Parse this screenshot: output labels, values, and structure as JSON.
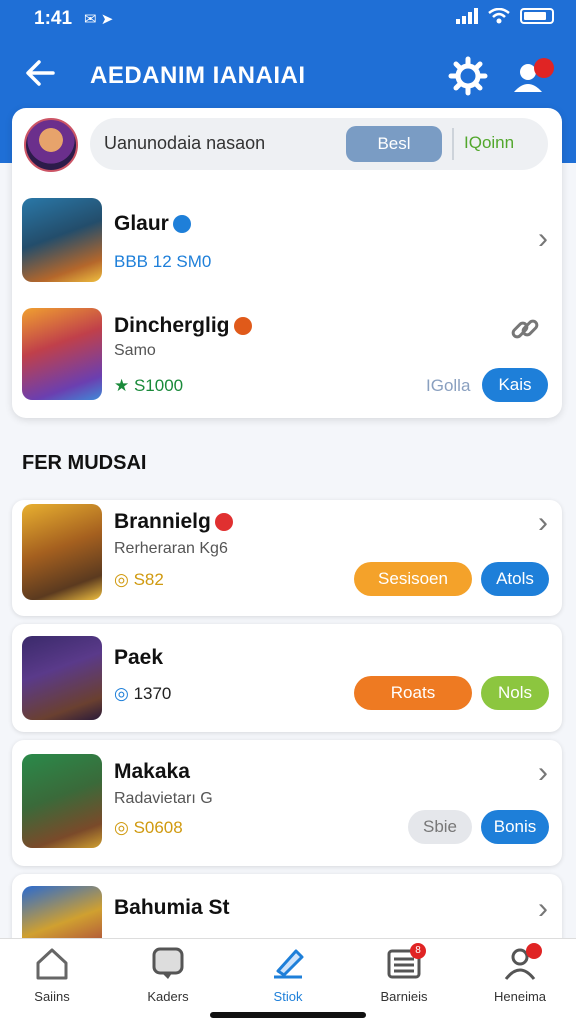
{
  "status": {
    "time": "1:41",
    "left_icons": "✉ ➤",
    "right_icons": [
      "signal-icon",
      "wifi-icon",
      "battery-icon"
    ]
  },
  "header": {
    "title": "AEDANIM IANAIAI"
  },
  "search": {
    "text": "Uanunodaia nasaon",
    "button": "Besl",
    "link": "IQoinn"
  },
  "featured": [
    {
      "name": "Glaur",
      "meta": "BBB  12  SM0",
      "action": "chevron"
    },
    {
      "name": "Dincherglig",
      "sub": "Samo",
      "meta": "★ S1000",
      "link": "IGolla",
      "button": "Kais"
    }
  ],
  "section_title": "FER MUDSAI",
  "list": [
    {
      "name": "Brannielg",
      "sub": "Rerheraran Kg6",
      "meta": "S82",
      "btn1": "Sesisoen",
      "btn2": "Atols"
    },
    {
      "name": "Paek",
      "meta": "1370",
      "btn1": "Roats",
      "btn2": "Nols"
    },
    {
      "name": "Makaka",
      "sub": "Radavietarı G",
      "meta": "S0608",
      "btn1": "Sbie",
      "btn2": "Bonis"
    },
    {
      "name": "Bahumia St"
    }
  ],
  "nav": [
    {
      "label": "Saiins",
      "icon": "home-icon"
    },
    {
      "label": "Kaders",
      "icon": "chat-icon"
    },
    {
      "label": "Stiok",
      "icon": "pencil-icon",
      "active": true
    },
    {
      "label": "Barnieis",
      "icon": "list-icon",
      "badge": "8"
    },
    {
      "label": "Heneima",
      "icon": "person-icon",
      "badge": ""
    }
  ],
  "colors": {
    "primary": "#1f6fd6",
    "orange": "#f4a22a",
    "deep_orange": "#ee7a22",
    "green": "#8cc63f",
    "blue_btn": "#1e7fd9",
    "grey_btn": "#e5e7eb"
  }
}
